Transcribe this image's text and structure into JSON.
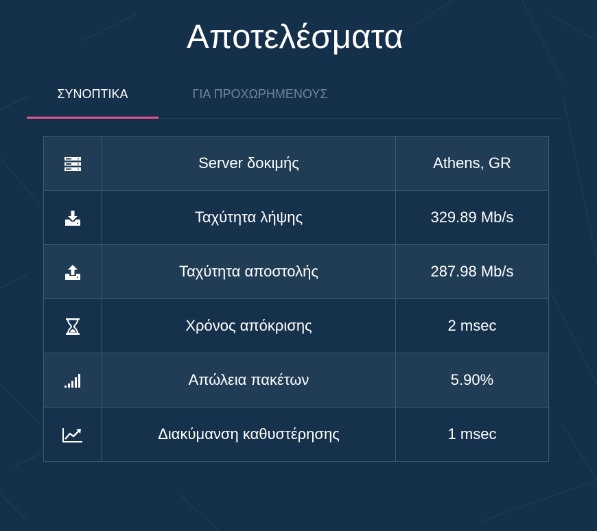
{
  "page": {
    "title": "Αποτελέσματα"
  },
  "tabs": [
    {
      "label": "ΣΥΝΟΠΤΙΚΑ",
      "active": true
    },
    {
      "label": "ΓΙΑ ΠΡΟΧΩΡΗΜΕΝΟΥΣ",
      "active": false
    }
  ],
  "results": [
    {
      "icon": "server-icon",
      "label": "Server δοκιμής",
      "value": "Athens, GR"
    },
    {
      "icon": "download-icon",
      "label": "Ταχύτητα λήψης",
      "value": "329.89 Mb/s"
    },
    {
      "icon": "upload-icon",
      "label": "Ταχύτητα αποστολής",
      "value": "287.98 Mb/s"
    },
    {
      "icon": "hourglass-icon",
      "label": "Χρόνος απόκρισης",
      "value": "2 msec"
    },
    {
      "icon": "signal-bars-icon",
      "label": "Απώλεια πακέτων",
      "value": "5.90%"
    },
    {
      "icon": "trend-chart-icon",
      "label": "Διακύμανση καθυστέρησης",
      "value": "1 msec"
    }
  ],
  "colors": {
    "background": "#15304a",
    "row_light": "#213d56",
    "row_dark": "#16314b",
    "border": "#3d5872",
    "accent": "#e8538d",
    "inactive_tab": "#6f8498"
  }
}
